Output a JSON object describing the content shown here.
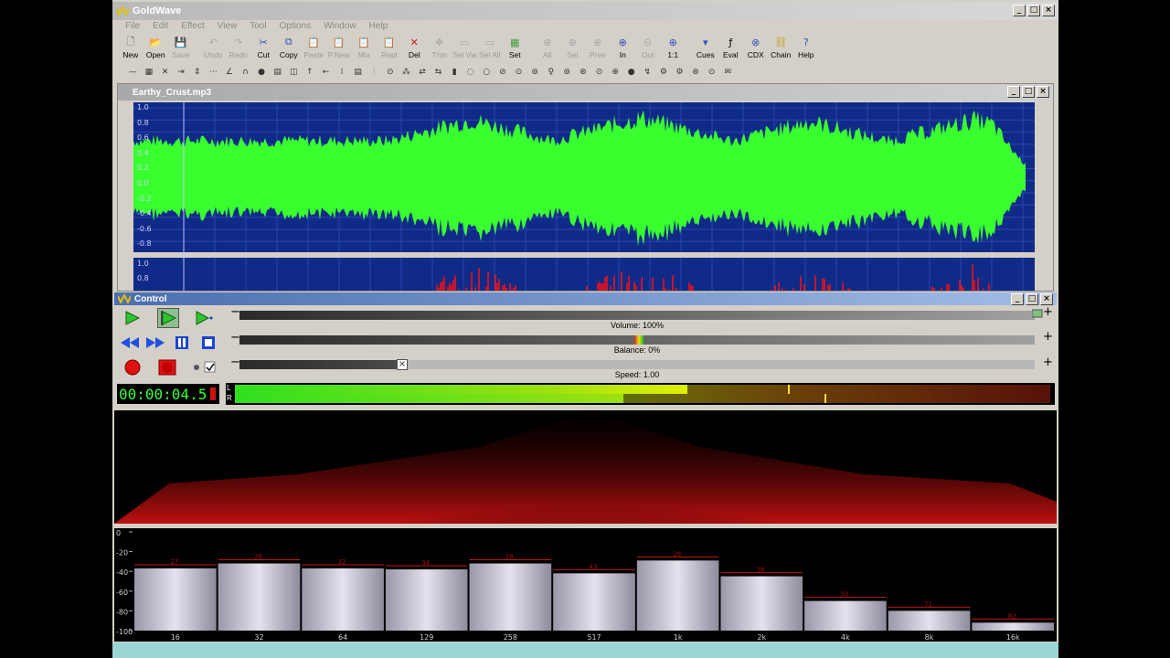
{
  "app": {
    "title": "GoldWave"
  },
  "menu": [
    "File",
    "Edit",
    "Effect",
    "View",
    "Tool",
    "Options",
    "Window",
    "Help"
  ],
  "toolbar": [
    {
      "label": "New",
      "icon": "new-icon",
      "active": true
    },
    {
      "label": "Open",
      "icon": "open-icon",
      "active": true
    },
    {
      "label": "Save",
      "icon": "save-icon",
      "active": false
    },
    {
      "sep": true
    },
    {
      "label": "Undo",
      "icon": "undo-icon",
      "active": false
    },
    {
      "label": "Redo",
      "icon": "redo-icon",
      "active": false
    },
    {
      "label": "Cut",
      "icon": "cut-icon",
      "active": true
    },
    {
      "label": "Copy",
      "icon": "copy-icon",
      "active": true
    },
    {
      "label": "Paste",
      "icon": "paste-icon",
      "active": false
    },
    {
      "label": "P.New",
      "icon": "paste-new-icon",
      "active": false
    },
    {
      "label": "Mix",
      "icon": "mix-icon",
      "active": false
    },
    {
      "label": "Repl",
      "icon": "replace-icon",
      "active": false
    },
    {
      "label": "Del",
      "icon": "delete-icon",
      "active": true
    },
    {
      "label": "Trim",
      "icon": "trim-icon",
      "active": false
    },
    {
      "label": "Sel Vw",
      "icon": "select-view-icon",
      "active": false
    },
    {
      "label": "Sel All",
      "icon": "select-all-icon",
      "active": false
    },
    {
      "label": "Set",
      "icon": "set-icon",
      "active": true
    },
    {
      "sep": true
    },
    {
      "label": "All",
      "icon": "zoom-all-icon",
      "active": false
    },
    {
      "label": "Sel",
      "icon": "zoom-selection-icon",
      "active": false
    },
    {
      "label": "Prev",
      "icon": "zoom-previous-icon",
      "active": false
    },
    {
      "label": "In",
      "icon": "zoom-in-icon",
      "active": true
    },
    {
      "label": "Out",
      "icon": "zoom-out-icon",
      "active": false
    },
    {
      "label": "1:1",
      "icon": "zoom-one-to-one-icon",
      "active": true
    },
    {
      "sep": true
    },
    {
      "label": "Cues",
      "icon": "cues-icon",
      "active": true
    },
    {
      "label": "Eval",
      "icon": "eval-icon",
      "active": true
    },
    {
      "label": "CDX",
      "icon": "cd-extract-icon",
      "active": true
    },
    {
      "label": "Chain",
      "icon": "chain-icon",
      "active": true
    },
    {
      "label": "Help",
      "icon": "help-icon",
      "active": true
    }
  ],
  "document": {
    "title": "Earthy_Crust.mp3",
    "scale_top": [
      "1.0",
      "0.8",
      "0.6",
      "0.4",
      "0.2",
      "0.0",
      "-0.2",
      "-0.4",
      "-0.6",
      "-0.8"
    ],
    "scale_bottom": [
      "1.0",
      "0.8"
    ]
  },
  "control": {
    "title": "Control",
    "volume": "Volume: 100%",
    "balance": "Balance: 0%",
    "speed": "Speed: 1.00",
    "time": "00:00:04.5",
    "level_left_label": "L",
    "level_right_label": "R"
  },
  "eq": {
    "y_labels": [
      "0",
      "-20",
      "-40",
      "-60",
      "-80",
      "-100"
    ],
    "bands": [
      {
        "freq": "16",
        "value": -37,
        "peak_label": "27"
      },
      {
        "freq": "32",
        "value": -32,
        "peak_label": "28"
      },
      {
        "freq": "64",
        "value": -37,
        "peak_label": "32"
      },
      {
        "freq": "129",
        "value": -38,
        "peak_label": "34"
      },
      {
        "freq": "258",
        "value": -32,
        "peak_label": "28"
      },
      {
        "freq": "517",
        "value": -42,
        "peak_label": "43"
      },
      {
        "freq": "1k",
        "value": -29,
        "peak_label": "28"
      },
      {
        "freq": "2k",
        "value": -45,
        "peak_label": "36"
      },
      {
        "freq": "4k",
        "value": -70,
        "peak_label": "50"
      },
      {
        "freq": "8k",
        "value": -80,
        "peak_label": "71"
      },
      {
        "freq": "16k",
        "value": -92,
        "peak_label": "82"
      }
    ]
  },
  "colors": {
    "wave": "#39ff2e",
    "wave_red": "#ff1010",
    "wave_bg": "#102a88"
  }
}
